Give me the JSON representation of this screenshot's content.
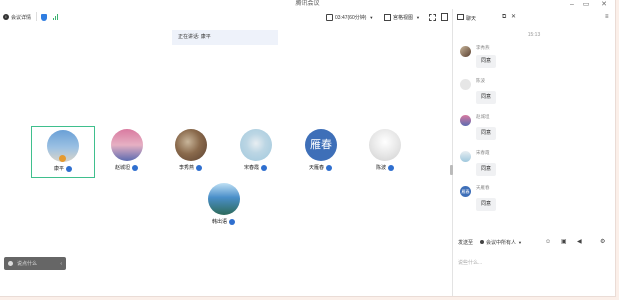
{
  "window": {
    "title": "腾讯会议",
    "minimize_icon": "minimize-icon",
    "maximize_icon": "maximize-icon",
    "close_icon": "close-icon"
  },
  "toolbar": {
    "meeting_info_label": "会议详情",
    "timer": "03:47(60分钟)",
    "view_label": "宫格视图",
    "chat_label": "聊天"
  },
  "banner": {
    "text": "正在讲话: 康平"
  },
  "participants": [
    {
      "name": "康平",
      "color_a": "#6aa0d6",
      "color_b": "#d9d4c9"
    },
    {
      "name": "赵城坦",
      "color_a": "#d97aa0",
      "color_b": "#5c6bb0"
    },
    {
      "name": "李秀燕",
      "color_a": "#5a4030",
      "color_b": "#c8b59a"
    },
    {
      "name": "宋春霞",
      "color_a": "#9fc8dd",
      "color_b": "#e8eef2"
    },
    {
      "name": "天雁春",
      "text": "雁春",
      "color_a": "#3e6fb8",
      "color_b": "#3e6fb8"
    },
    {
      "name": "陈波",
      "color_a": "#d8d8d8",
      "color_b": "#f3f3f3"
    },
    {
      "name": "韩出语",
      "color_a": "#4a8fc9",
      "color_b": "#2d6a5a"
    }
  ],
  "left_chat": {
    "placeholder": "说点什么"
  },
  "chat": {
    "time": "15:13",
    "messages": [
      {
        "name": "李秀燕",
        "text": "同意"
      },
      {
        "name": "陈波",
        "text": "同意"
      },
      {
        "name": "赵城坦",
        "text": "同意"
      },
      {
        "name": "宋春霞",
        "text": "同意"
      },
      {
        "name": "天雁春",
        "text": "同意"
      }
    ],
    "send_to_label": "发送至",
    "send_to_value": "会议中所有人",
    "input_placeholder": "说些什么..."
  },
  "colors": {
    "accent": "#2f6fcf",
    "selected_border": "#3fbf8d"
  }
}
